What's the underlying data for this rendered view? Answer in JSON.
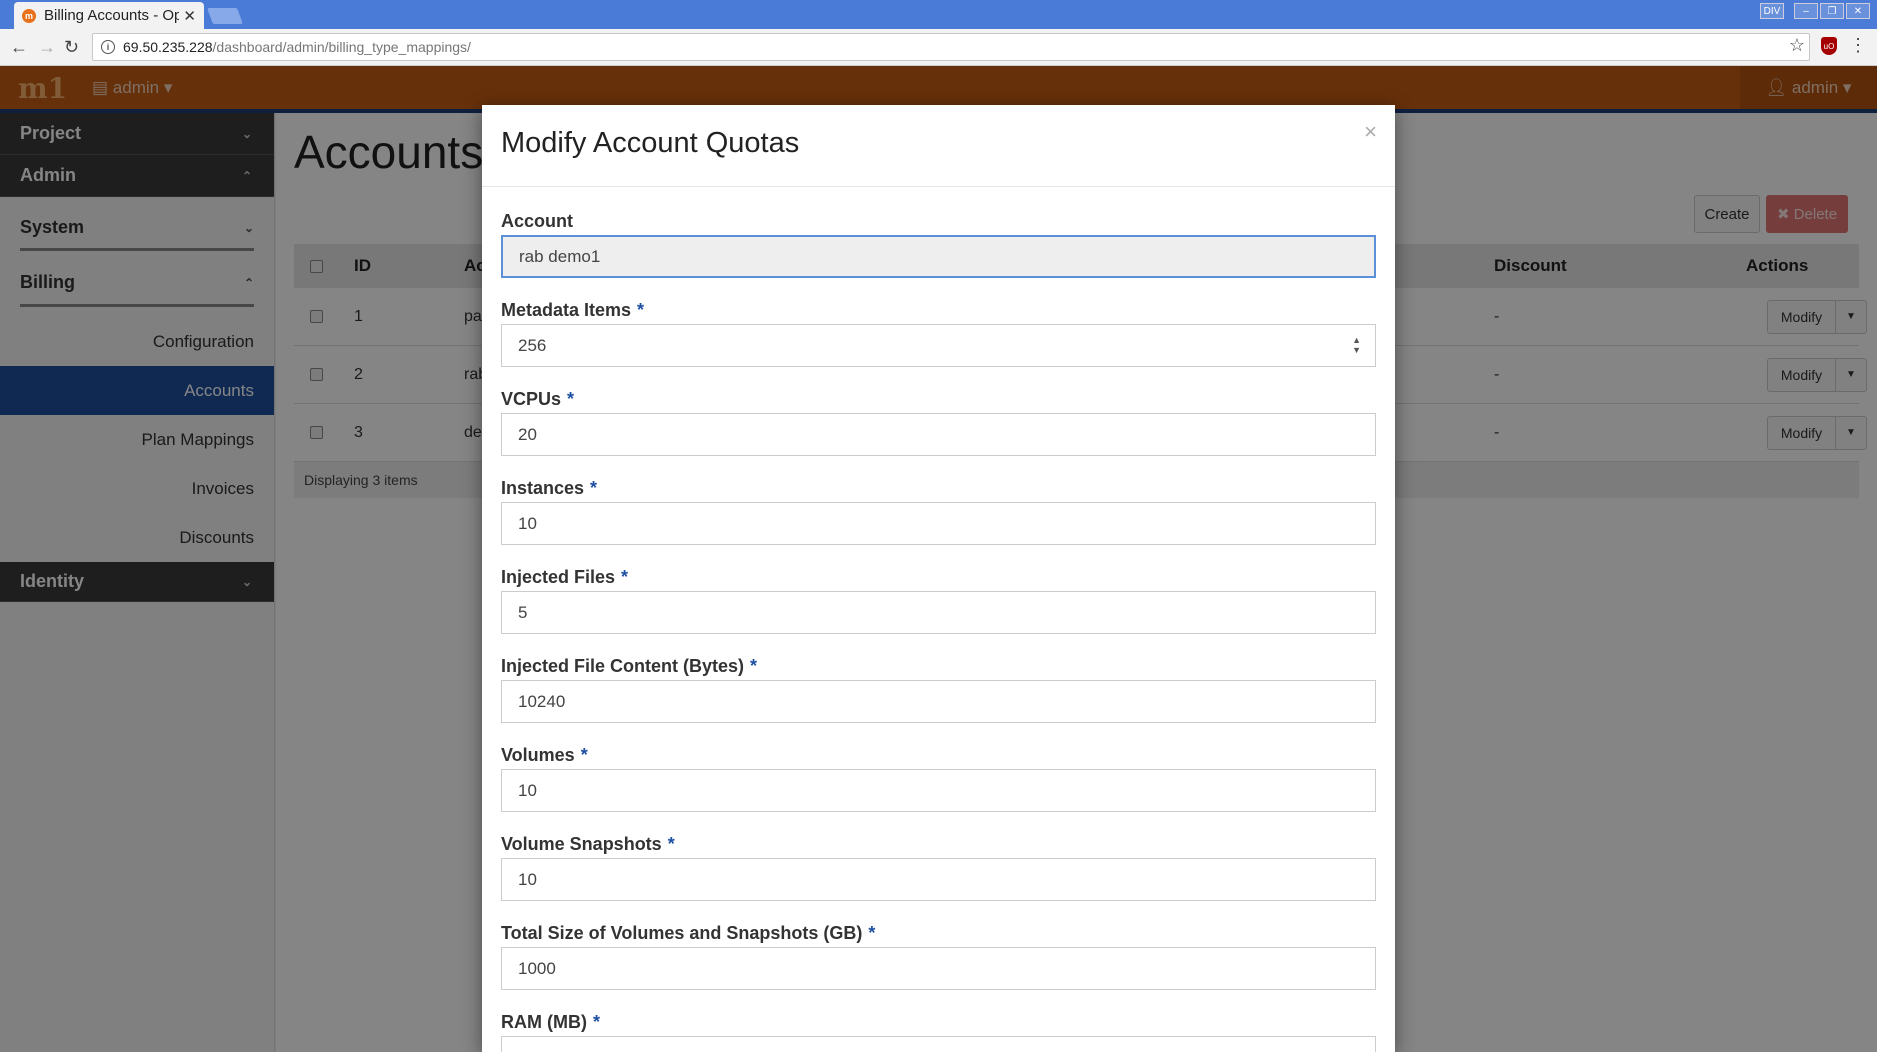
{
  "browser": {
    "tab_title": "Billing Accounts - Op",
    "tab_close": "✕",
    "win_btn_div": "DIV",
    "url_host": "69.50.235.228",
    "url_path": "/dashboard/admin/billing_type_mappings/"
  },
  "header": {
    "logo": "m1",
    "project_label": "admin",
    "user_label": "admin"
  },
  "sidebar": {
    "sections": [
      {
        "label": "Project"
      },
      {
        "label": "Admin"
      }
    ],
    "system_label": "System",
    "billing_label": "Billing",
    "billing_items": [
      "Configuration",
      "Accounts",
      "Plan Mappings",
      "Invoices",
      "Discounts"
    ],
    "identity_label": "Identity"
  },
  "main": {
    "title": "Accounts",
    "create_label": "Create",
    "delete_label": "Delete",
    "columns": {
      "id": "ID",
      "account": "Ac",
      "discount": "Discount",
      "actions": "Actions"
    },
    "rows": [
      {
        "id": "1",
        "account": "pa",
        "discount": "-",
        "action": "Modify"
      },
      {
        "id": "2",
        "account": "rab",
        "discount": "-",
        "action": "Modify"
      },
      {
        "id": "3",
        "account": "de",
        "discount": "-",
        "action": "Modify"
      }
    ],
    "footer": "Displaying 3 items"
  },
  "modal": {
    "title": "Modify Account Quotas",
    "close": "×",
    "fields": [
      {
        "label": "Account",
        "value": "rab demo1",
        "required": false
      },
      {
        "label": "Metadata Items",
        "value": "256",
        "required": true
      },
      {
        "label": "VCPUs",
        "value": "20",
        "required": true
      },
      {
        "label": "Instances",
        "value": "10",
        "required": true
      },
      {
        "label": "Injected Files",
        "value": "5",
        "required": true
      },
      {
        "label": "Injected File Content (Bytes)",
        "value": "10240",
        "required": true
      },
      {
        "label": "Volumes",
        "value": "10",
        "required": true
      },
      {
        "label": "Volume Snapshots",
        "value": "10",
        "required": true
      },
      {
        "label": "Total Size of Volumes and Snapshots (GB)",
        "value": "1000",
        "required": true
      },
      {
        "label": "RAM (MB)",
        "value": "",
        "required": true
      }
    ],
    "required_marker": "*"
  }
}
